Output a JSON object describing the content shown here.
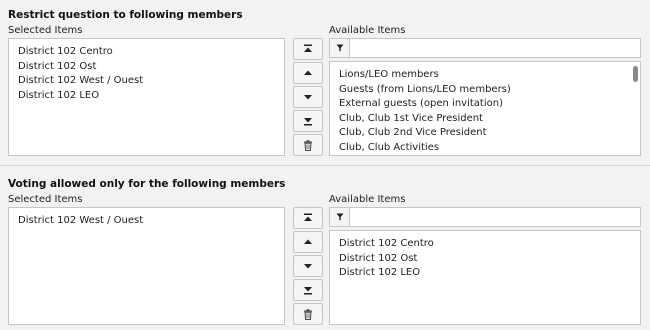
{
  "section1": {
    "title": "Restrict question to following members",
    "selected_label": "Selected Items",
    "available_label": "Available Items",
    "selected_items": [
      "District 102 Centro",
      "District 102 Ost",
      "District 102 West / Ouest",
      "District 102 LEO"
    ],
    "available_items": [
      "Lions/LEO members",
      "Guests (from Lions/LEO members)",
      "External guests (open invitation)",
      "Club, Club 1st Vice President",
      "Club, Club 2nd Vice President",
      "Club, Club Activities"
    ],
    "filter_value": ""
  },
  "section2": {
    "title": "Voting allowed only for the following members",
    "selected_label": "Selected Items",
    "available_label": "Available Items",
    "selected_items": [
      "District 102 West / Ouest"
    ],
    "available_items": [
      "District 102 Centro",
      "District 102 Ost",
      "District 102 LEO"
    ],
    "filter_value": ""
  },
  "icons": {
    "move_top": "move-to-top-icon",
    "move_up": "move-up-icon",
    "move_down": "move-down-icon",
    "move_bottom": "move-to-bottom-icon",
    "remove": "trash-icon",
    "filter": "filter-icon"
  }
}
